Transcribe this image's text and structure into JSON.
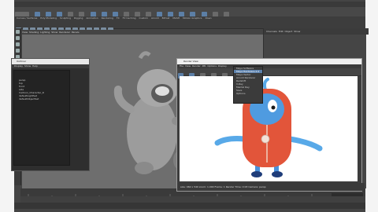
{
  "app": {
    "menus": [
      "File",
      "Edit",
      "Create",
      "Select",
      "Modify",
      "Display",
      "Windows",
      "Mesh",
      "Edit Mesh",
      "Mesh Tools",
      "Mesh Display",
      "Curves",
      "Surfaces",
      "Deform",
      "UV",
      "Generate",
      "Cache",
      "Arnold",
      "Help"
    ]
  },
  "shelf": {
    "tabs": [
      "Curves / Surfaces",
      "Poly Modeling",
      "Sculpting",
      "Rigging",
      "Animation",
      "Rendering",
      "FX",
      "FX Caching",
      "Custom",
      "Arnold",
      "Bifrost",
      "MASH",
      "Motion Graphics",
      "XGen"
    ]
  },
  "viewport": {
    "menus": [
      "View",
      "Shading",
      "Lighting",
      "Show",
      "Renderer",
      "Panels"
    ]
  },
  "outliner": {
    "title": "Outliner",
    "menus": [
      "Display",
      "Show",
      "Help"
    ],
    "items": [
      "persp",
      "top",
      "front",
      "side",
      "Cartoon_Character_R",
      "defaultLightSet",
      "defaultObjectSet"
    ]
  },
  "render_view": {
    "title": "Render View",
    "menus": [
      "File",
      "View",
      "Render",
      "IPR",
      "Options",
      "Display"
    ],
    "status": "size: 960 x 540  zoom: 1.000   Frame: 1   Render Time: 0:03   Camera: persp",
    "dropdown": [
      "Maya Software",
      "Maya Hardware 2.0",
      "Maya Vector",
      "Arnold Renderer",
      "Redshift",
      "V-Ray",
      "Mental Ray",
      "Save",
      "Options"
    ]
  },
  "right_panel": {
    "tabs": [
      "Channels",
      "Edit",
      "Object",
      "Show"
    ]
  },
  "icons": {
    "search": "search-icon",
    "camera": "camera-icon"
  },
  "colors": {
    "body_orange": "#e2553a",
    "arms_blue": "#58a9e8",
    "accent_blue": "#5d82ad"
  }
}
